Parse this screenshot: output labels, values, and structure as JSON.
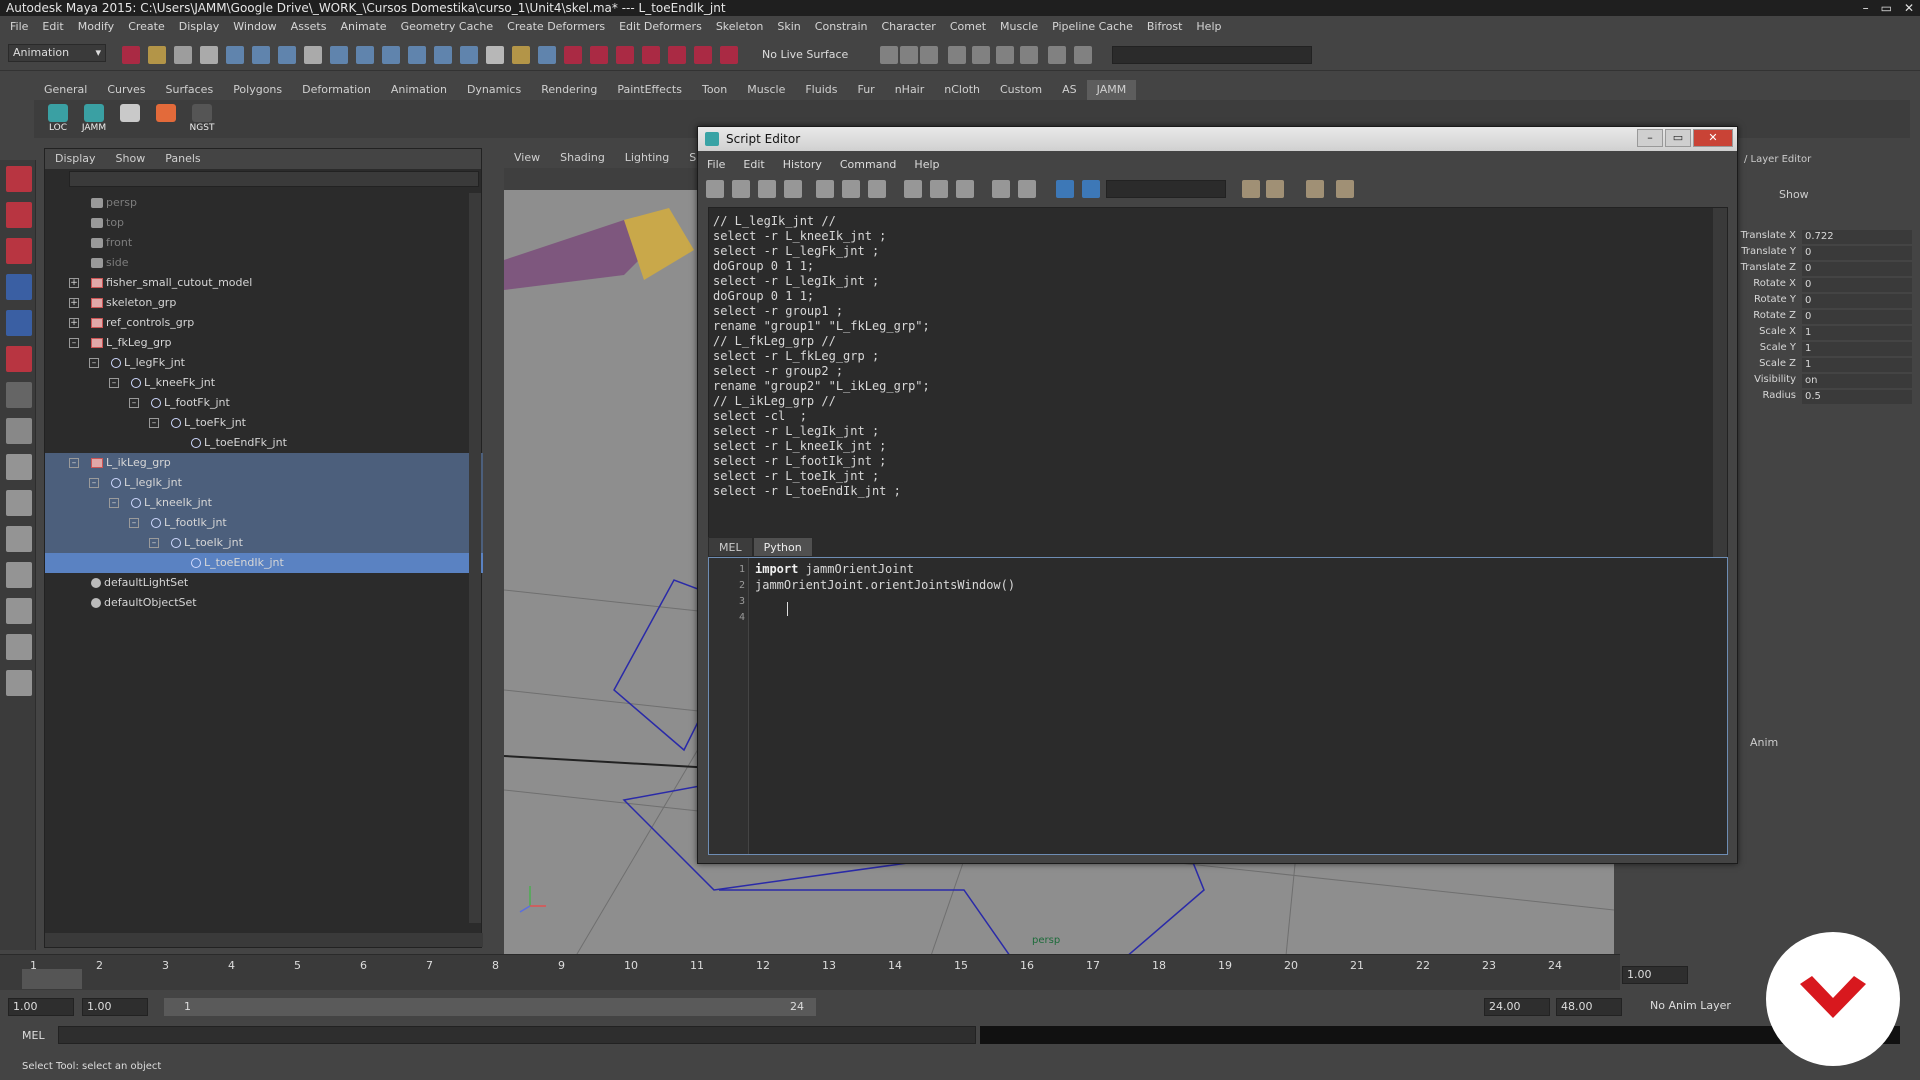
{
  "window": {
    "title": "Autodesk Maya 2015: C:\\Users\\JAMM\\Google Drive\\_WORK_\\Cursos Domestika\\curso_1\\Unit4\\skel.ma*  ---  L_toeEndIk_jnt",
    "controls": [
      "–",
      "▭",
      "✕"
    ]
  },
  "menubar": [
    "File",
    "Edit",
    "Modify",
    "Create",
    "Display",
    "Window",
    "Assets",
    "Animate",
    "Geometry Cache",
    "Create Deformers",
    "Edit Deformers",
    "Skeleton",
    "Skin",
    "Constrain",
    "Character",
    "Comet",
    "Muscle",
    "Pipeline Cache",
    "Bifrost",
    "Help"
  ],
  "statusline": {
    "mode": "Animation",
    "live_surface": "No Live Surface"
  },
  "shelf": {
    "tabs": [
      "General",
      "Curves",
      "Surfaces",
      "Polygons",
      "Deformation",
      "Animation",
      "Dynamics",
      "Rendering",
      "PaintEffects",
      "Toon",
      "Muscle",
      "Fluids",
      "Fur",
      "nHair",
      "nCloth",
      "Custom",
      "AS",
      "JAMM"
    ],
    "active_tab": "JAMM",
    "buttons": [
      {
        "label": "LOC",
        "color": "#3aa0a3"
      },
      {
        "label": "JAMM",
        "color": "#3aa0a3"
      },
      {
        "label": "",
        "color": "#c9c9c9"
      },
      {
        "label": "",
        "color": "#e36a3a"
      },
      {
        "label": "NGST",
        "color": "#555555"
      }
    ]
  },
  "outliner": {
    "menu": [
      "Display",
      "Show",
      "Panels"
    ],
    "items": [
      {
        "label": "persp",
        "indent": 0,
        "type": "camera",
        "dim": true
      },
      {
        "label": "top",
        "indent": 0,
        "type": "camera",
        "dim": true
      },
      {
        "label": "front",
        "indent": 0,
        "type": "camera",
        "dim": true
      },
      {
        "label": "side",
        "indent": 0,
        "type": "camera",
        "dim": true
      },
      {
        "label": "fisher_small_cutout_model",
        "indent": 0,
        "type": "group",
        "expander": "+"
      },
      {
        "label": "skeleton_grp",
        "indent": 0,
        "type": "group",
        "expander": "+"
      },
      {
        "label": "ref_controls_grp",
        "indent": 0,
        "type": "group",
        "expander": "+"
      },
      {
        "label": "L_fkLeg_grp",
        "indent": 0,
        "type": "group",
        "expander": "–"
      },
      {
        "label": "L_legFk_jnt",
        "indent": 1,
        "type": "joint",
        "expander": "–"
      },
      {
        "label": "L_kneeFk_jnt",
        "indent": 2,
        "type": "joint",
        "expander": "–"
      },
      {
        "label": "L_footFk_jnt",
        "indent": 3,
        "type": "joint",
        "expander": "–"
      },
      {
        "label": "L_toeFk_jnt",
        "indent": 4,
        "type": "joint",
        "expander": "–"
      },
      {
        "label": "L_toeEndFk_jnt",
        "indent": 5,
        "type": "joint"
      },
      {
        "label": "L_ikLeg_grp",
        "indent": 0,
        "type": "group",
        "expander": "–",
        "selected": "band"
      },
      {
        "label": "L_legIk_jnt",
        "indent": 1,
        "type": "joint",
        "expander": "–",
        "selected": "band"
      },
      {
        "label": "L_kneeIk_jnt",
        "indent": 2,
        "type": "joint",
        "expander": "–",
        "selected": "band"
      },
      {
        "label": "L_footIk_jnt",
        "indent": 3,
        "type": "joint",
        "expander": "–",
        "selected": "band"
      },
      {
        "label": "L_toeIk_jnt",
        "indent": 4,
        "type": "joint",
        "expander": "–",
        "selected": "band"
      },
      {
        "label": "L_toeEndIk_jnt",
        "indent": 5,
        "type": "joint",
        "selected": "row"
      },
      {
        "label": "defaultLightSet",
        "indent": 0,
        "type": "set"
      },
      {
        "label": "defaultObjectSet",
        "indent": 0,
        "type": "set"
      }
    ]
  },
  "viewport": {
    "menu": [
      "View",
      "Shading",
      "Lighting",
      "Show"
    ],
    "camera_label": "persp"
  },
  "attributes": {
    "tab_right": "Show",
    "title": "/ Layer Editor",
    "rows": [
      {
        "name": "Translate X",
        "value": "0.722"
      },
      {
        "name": "Translate Y",
        "value": "0"
      },
      {
        "name": "Translate Z",
        "value": "0"
      },
      {
        "name": "Rotate X",
        "value": "0"
      },
      {
        "name": "Rotate Y",
        "value": "0"
      },
      {
        "name": "Rotate Z",
        "value": "0"
      },
      {
        "name": "Scale X",
        "value": "1"
      },
      {
        "name": "Scale Y",
        "value": "1"
      },
      {
        "name": "Scale Z",
        "value": "1"
      },
      {
        "name": "Visibility",
        "value": "on"
      },
      {
        "name": "Radius",
        "value": "0.5"
      }
    ],
    "anim_tab": "Anim"
  },
  "script_editor": {
    "title": "Script Editor",
    "menu": [
      "File",
      "Edit",
      "History",
      "Command",
      "Help"
    ],
    "history": [
      "// L_legIk_jnt //",
      "select -r L_kneeIk_jnt ;",
      "select -r L_legFk_jnt ;",
      "doGroup 0 1 1;",
      "select -r L_legIk_jnt ;",
      "doGroup 0 1 1;",
      "select -r group1 ;",
      "rename \"group1\" \"L_fkLeg_grp\";",
      "// L_fkLeg_grp //",
      "select -r L_fkLeg_grp ;",
      "select -r group2 ;",
      "rename \"group2\" \"L_ikLeg_grp\";",
      "// L_ikLeg_grp //",
      "select -cl  ;",
      "select -r L_legIk_jnt ;",
      "select -r L_kneeIk_jnt ;",
      "select -r L_footIk_jnt ;",
      "select -r L_toeIk_jnt ;",
      "select -r L_toeEndIk_jnt ;"
    ],
    "tabs": [
      "MEL",
      "Python"
    ],
    "active_tab": "Python",
    "line_numbers": [
      "1",
      "2",
      "3",
      "4"
    ],
    "code": {
      "line1_kw": "import",
      "line1_rest": " jammOrientJoint",
      "line2": "jammOrientJoint.orientJointsWindow()"
    }
  },
  "timeline": {
    "ticks": [
      "1",
      "2",
      "3",
      "4",
      "5",
      "6",
      "7",
      "8",
      "9",
      "10",
      "11",
      "12",
      "13",
      "14",
      "15",
      "16",
      "17",
      "18",
      "19",
      "20",
      "21",
      "22",
      "23",
      "24"
    ],
    "current_frame": "1.00"
  },
  "range": {
    "start": "1.00",
    "playback_start": "1.00",
    "range_start_label": "1",
    "range_end_label": "24",
    "playback_end": "24.00",
    "end": "48.00",
    "anim_layer": "No Anim Layer"
  },
  "commandline": {
    "label": "MEL"
  },
  "helpline": {
    "text": "Select Tool: select an object"
  }
}
